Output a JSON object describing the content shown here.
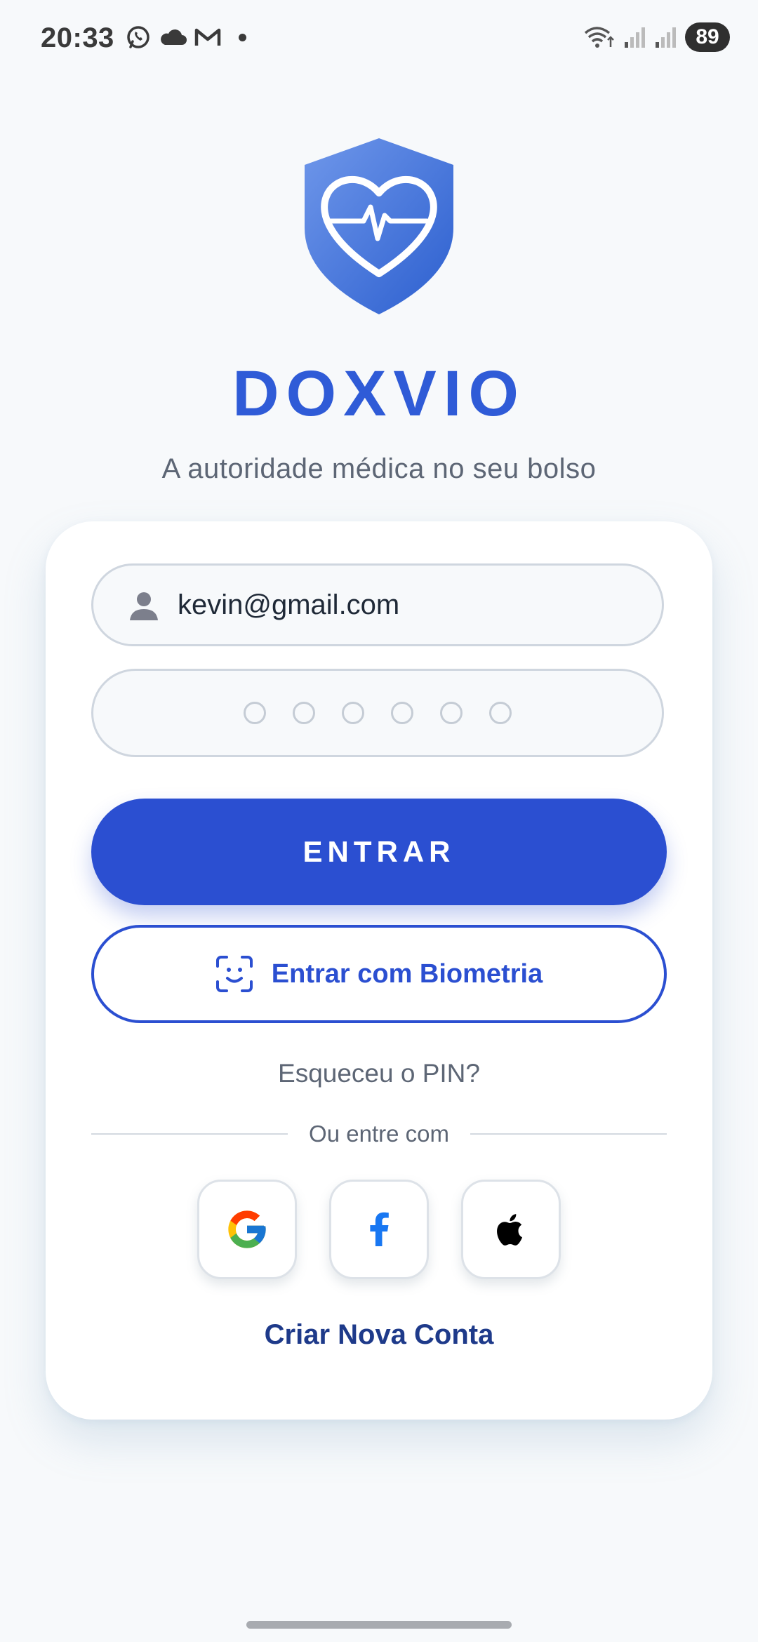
{
  "status_bar": {
    "time": "20:33",
    "battery": "89",
    "icons": [
      "whatsapp-icon",
      "cloud-icon",
      "gmail-icon",
      "notification-dot",
      "wifi-icon",
      "signal-icon",
      "signal-icon-2",
      "battery-icon"
    ]
  },
  "app": {
    "brand": "DOXVIO",
    "tagline": "A autoridade médica no seu bolso",
    "logo_icon": "shield-heart-pulse-icon"
  },
  "login": {
    "email_value": "kevin@gmail.com",
    "pin_length": 6,
    "enter_label": "ENTRAR",
    "biometric_label": "Entrar com Biometria",
    "forgot_label": "Esqueceu o PIN?",
    "divider_text": "Ou entre com",
    "social": [
      "google-icon",
      "facebook-icon",
      "apple-icon"
    ],
    "create_account_label": "Criar Nova Conta"
  },
  "colors": {
    "primary": "#2b4fd1",
    "brand_text": "#2f5bd7",
    "link_dark": "#1e3a8a",
    "background": "#f7f9fb",
    "card": "#ffffff"
  }
}
